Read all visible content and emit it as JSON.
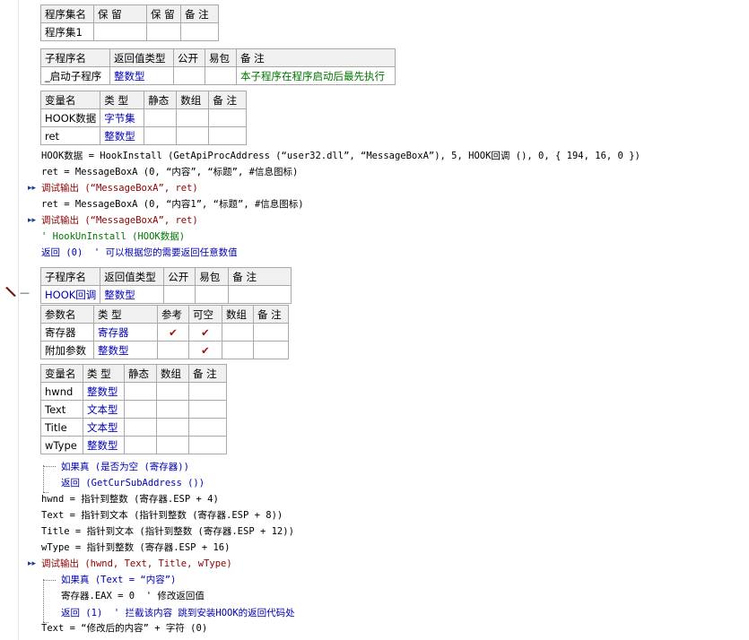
{
  "assembly_table": {
    "headers": [
      "程序集名",
      "保 留",
      "保 留",
      "备 注"
    ],
    "row": [
      "程序集1",
      "",
      "",
      ""
    ]
  },
  "sub1": {
    "headers": [
      "子程序名",
      "返回值类型",
      "公开",
      "易包",
      "备 注"
    ],
    "row": [
      "_启动子程序",
      "整数型",
      "",
      "",
      "本子程序在程序启动后最先执行"
    ]
  },
  "vars1": {
    "headers": [
      "变量名",
      "类 型",
      "静态",
      "数组",
      "备 注"
    ],
    "rows": [
      [
        "HOOK数据",
        "字节集",
        "",
        "",
        ""
      ],
      [
        "ret",
        "整数型",
        "",
        "",
        ""
      ]
    ]
  },
  "code1": [
    "HOOK数据 = HookInstall (GetApiProcAddress (“user32.dll”, “MessageBoxA”), 5, HOOK回调 (), 0, { 194, 16, 0 })",
    "ret = MessageBoxA (0, “内容”, “标题”, #信息图标)",
    "调试输出 (“MessageBoxA”, ret)",
    "ret = MessageBoxA (0, “内容1”, “标题”, #信息图标)",
    "调试输出 (“MessageBoxA”, ret)",
    "' HookUnInstall (HOOK数据)",
    "返回 (0)  ' 可以根据您的需要返回任意数值"
  ],
  "sub2": {
    "headers": [
      "子程序名",
      "返回值类型",
      "公开",
      "易包",
      "备 注"
    ],
    "row": [
      "HOOK回调",
      "整数型",
      "",
      "",
      ""
    ]
  },
  "params2": {
    "headers": [
      "参数名",
      "类 型",
      "参考",
      "可空",
      "数组",
      "备 注"
    ],
    "rows": [
      [
        "寄存器",
        "寄存器",
        "✔",
        "✔",
        "",
        ""
      ],
      [
        "附加参数",
        "整数型",
        "",
        "✔",
        "",
        ""
      ]
    ]
  },
  "vars2": {
    "headers": [
      "变量名",
      "类 型",
      "静态",
      "数组",
      "备 注"
    ],
    "rows": [
      [
        "hwnd",
        "整数型",
        "",
        "",
        ""
      ],
      [
        "Text",
        "文本型",
        "",
        "",
        ""
      ],
      [
        "Title",
        "文本型",
        "",
        "",
        ""
      ],
      [
        "wType",
        "整数型",
        "",
        "",
        ""
      ]
    ]
  },
  "code2": [
    "如果真 (是否为空 (寄存器))",
    "返回 (GetCurSubAddress ())",
    "hwnd = 指针到整数 (寄存器.ESP + 4)",
    "Text = 指针到文本 (指针到整数 (寄存器.ESP + 8))",
    "Title = 指针到文本 (指针到整数 (寄存器.ESP + 12))",
    "wType = 指针到整数 (寄存器.ESP + 16)",
    "调试输出 (hwnd, Text, Title, wType)",
    "如果真 (Text = “内容”)",
    "寄存器.EAX = 0  ' 修改返回值",
    "返回 (1)  ' 拦截该内容 跳到安装HOOK的返回代码处",
    "Text = “修改后的内容” + 字符 (0)"
  ],
  "colors": {
    "keyword": "#8b0000",
    "string": "#0000b0",
    "comment": "#007500",
    "type": "#0000b0"
  }
}
